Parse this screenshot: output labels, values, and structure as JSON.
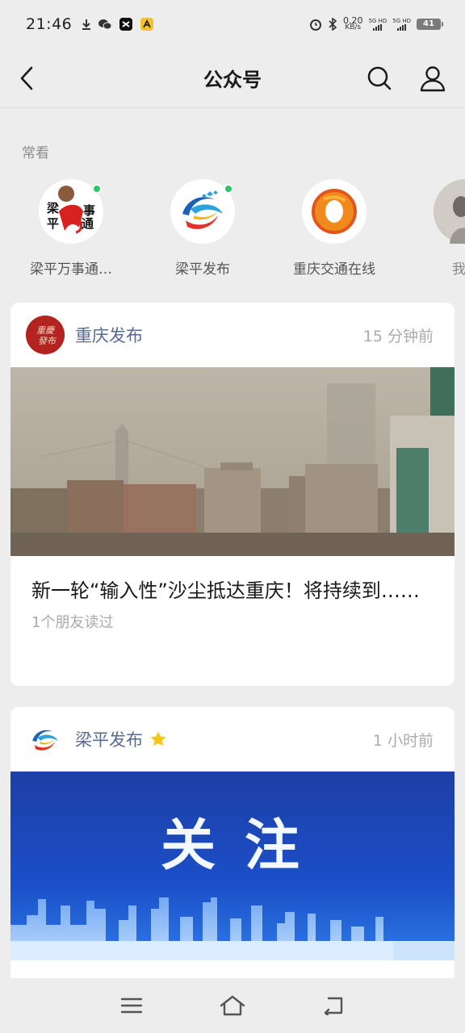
{
  "status_bar": {
    "time": "21:46",
    "speed_value": "0.20",
    "speed_unit": "KB/s",
    "network_1": "5G HD",
    "network_2": "5G HD",
    "battery": "41"
  },
  "header": {
    "title": "公众号",
    "back_icon": "chevron-left-icon",
    "search_icon": "search-icon",
    "profile_icon": "person-icon"
  },
  "frequent": {
    "label": "常看",
    "items": [
      {
        "name": "梁平万事通…",
        "logo_text_top": "梁",
        "logo_text_mid": "平",
        "logo_text_r1": "事",
        "logo_text_r2": "通",
        "has_update": true
      },
      {
        "name": "梁平发布",
        "has_update": true
      },
      {
        "name": "重庆交通在线",
        "has_update": false
      },
      {
        "name": "我是",
        "has_update": false
      }
    ]
  },
  "feed": [
    {
      "source": "重庆发布",
      "time": "15 分钟前",
      "title": "新一轮“输入性”沙尘抵达重庆！将持续到……",
      "meta": "1个朋友读过",
      "logo_text": "重庆发布"
    },
    {
      "source": "梁平发布",
      "time": "1 小时前",
      "image_text": "关 注",
      "starred": true
    }
  ],
  "nav": {
    "menu_icon": "menu-icon",
    "home_icon": "home-icon",
    "back_icon": "back-icon"
  },
  "colors": {
    "background": "#ededed",
    "link_blue": "#576b95",
    "online_green": "#2bc56a",
    "star_yellow": "#f5c518",
    "banner_blue": "#1a45b8"
  }
}
